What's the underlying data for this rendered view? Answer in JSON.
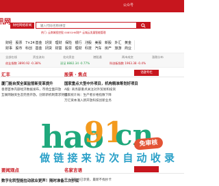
{
  "topbar": {
    "left_label": "公众号"
  },
  "header": {
    "logo": "讯网",
    "news_tag": "财经网络新闻",
    "search_placeholder": "输入代码/名称/拼音",
    "hotwords": "热门: 云南城投控股  00851HK财产  云城云发展智能管理"
  },
  "nav": {
    "row1": [
      "财经",
      "股票",
      "7×24",
      "基金",
      "期货",
      "理财",
      "保险",
      "银行",
      "港股",
      "美股",
      "新股",
      "外汇",
      "黄金"
    ],
    "row2": [
      "财事",
      "股市",
      "科创",
      "基金",
      "期货",
      "财富",
      "股票",
      "理财",
      "科技",
      "汽车",
      "房产",
      "旅游",
      "商业"
    ]
  },
  "sitebar": {
    "cols": [
      "全部在线",
      "资金流向",
      "北向资金",
      "港股通",
      "两市成交",
      "涨跌分布"
    ],
    "vals": [
      "创业指数 3890.92 -0.38%",
      "深证 8882.34 -0.77%",
      "科创板指数 1963.38 -0.4%"
    ]
  },
  "sections": {
    "left_title": "汇丰",
    "mid_title": "股票 · 焦点",
    "right_title": "话题专栏",
    "bottom_left_title": "要闻观点",
    "bottom_mid_title": "名家言语"
  },
  "headlines": {
    "left_main": "厦门能自贸全面监管新变革提升",
    "mid_main": "国家重点大型中外项目，机构精准筹划好项目",
    "left_lines": [
      "香港首季内部经济数据发布，市场全面开放",
      "互联网融资生态完善开放，创新新机制需求持续"
    ],
    "mid_lines": [
      "A股: 商务部重点关注对外贸易和投资",
      "国家统计局：生产者价格指数下降",
      "万亿资本涌入新开放科技创新业务"
    ],
    "bottom_left": "数字化转型能拉动就业更声！随时准备二次抄底",
    "bottom_mid": "第一支持台已享受，最新不找抄卡"
  },
  "watermark": {
    "main": "hao",
    "mid": "91",
    "tail": "cn",
    "badge": "免审核",
    "slogan": "做  链  接  来  访    次  自  动  收  录"
  },
  "colors": {
    "brand": "#c7161e",
    "watermark_green": "#1fa87c",
    "watermark_orange": "#f39a1e"
  }
}
